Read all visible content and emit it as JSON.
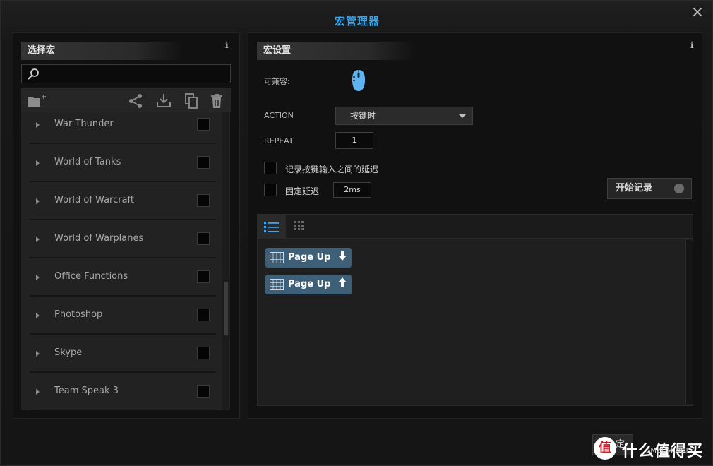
{
  "window": {
    "title": "宏管理器",
    "close": "×"
  },
  "left": {
    "header": "选择宏",
    "info": "i",
    "search": {
      "placeholder": "",
      "value": ""
    },
    "toolbar": [
      "new-folder-icon",
      "share-icon",
      "download-icon",
      "copy-icon",
      "trash-icon"
    ],
    "items": [
      {
        "label": "War Thunder",
        "checked": false
      },
      {
        "label": "World of Tanks",
        "checked": false
      },
      {
        "label": "World of Warcraft",
        "checked": false
      },
      {
        "label": "World of Warplanes",
        "checked": false
      },
      {
        "label": "Office Functions",
        "checked": false
      },
      {
        "label": "Photoshop",
        "checked": false
      },
      {
        "label": "Skype",
        "checked": false
      },
      {
        "label": "Team Speak 3",
        "checked": false
      }
    ]
  },
  "right": {
    "header": "宏设置",
    "info": "i",
    "compatible_label": "可兼容:",
    "action_label": "ACTION",
    "action_value": "按键时",
    "repeat_label": "REPEAT",
    "repeat_value": "1",
    "record_delay_label": "记录按键输入之间的延迟",
    "fixed_delay_label": "固定延迟",
    "fixed_delay_value": "2ms",
    "record_button": "开始记录",
    "events": [
      {
        "key": "Page Up",
        "direction": "down"
      },
      {
        "key": "Page Up",
        "direction": "up"
      }
    ]
  },
  "footer": {
    "ok_label": "定",
    "watermark": "值 什么值得买",
    "watermark_site": "SMZDM.NET"
  },
  "colors": {
    "accent": "#39a8ef",
    "event_chip": "#3d5f78"
  }
}
